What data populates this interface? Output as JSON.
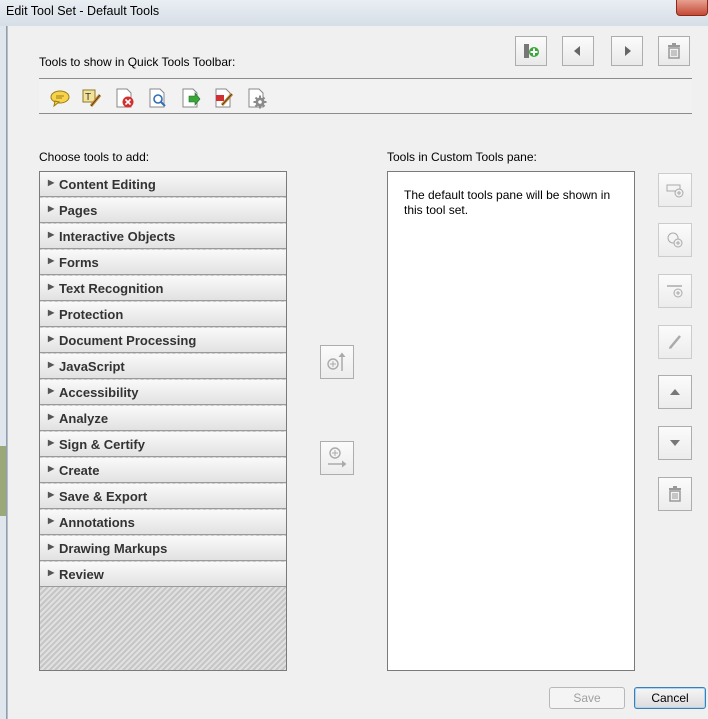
{
  "window": {
    "title": "Edit Tool Set - Default Tools"
  },
  "quick_tools": {
    "label": "Tools to show in Quick Tools Toolbar:",
    "icons": [
      "comment-icon",
      "edit-text-icon",
      "delete-icon",
      "search-icon",
      "export-icon",
      "edit-pdf-icon",
      "settings-icon"
    ]
  },
  "choose": {
    "label": "Choose tools to add:",
    "categories": [
      "Content Editing",
      "Pages",
      "Interactive Objects",
      "Forms",
      "Text Recognition",
      "Protection",
      "Document Processing",
      "JavaScript",
      "Accessibility",
      "Analyze",
      "Sign & Certify",
      "Create",
      "Save & Export",
      "Annotations",
      "Drawing Markups",
      "Review"
    ]
  },
  "custom_pane": {
    "label": "Tools in Custom Tools pane:",
    "message": "The default tools pane will be shown in this tool set."
  },
  "buttons": {
    "save": "Save",
    "cancel": "Cancel"
  }
}
